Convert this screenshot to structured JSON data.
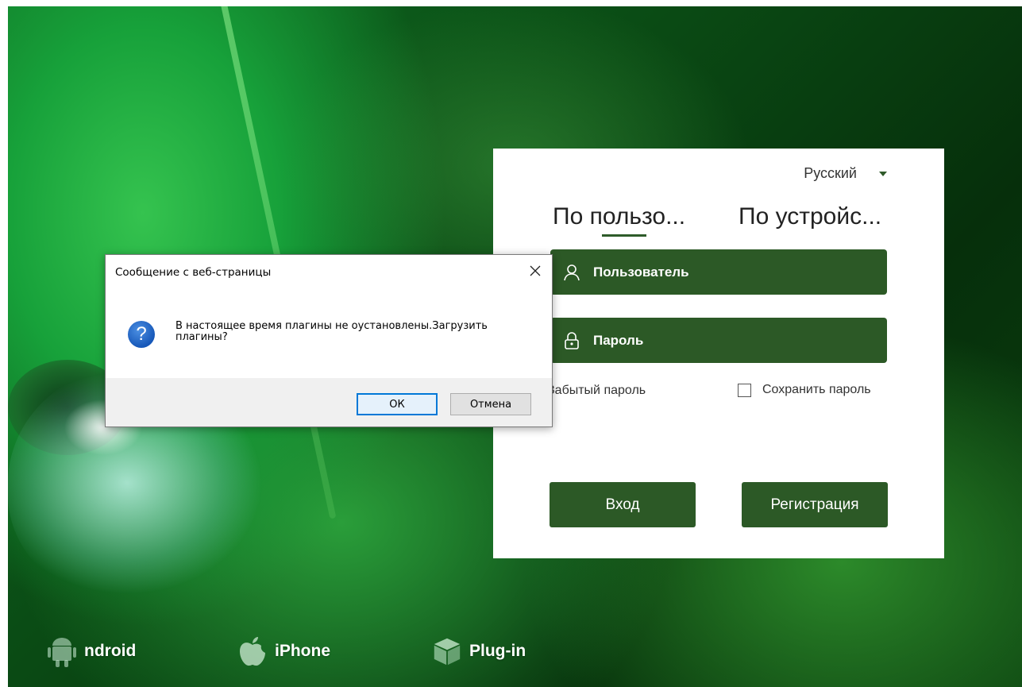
{
  "colors": {
    "accent_green": "#2c5926",
    "panel_bg": "#ffffff",
    "dialog_ok_border": "#0078d7"
  },
  "downloads": [
    {
      "label": "ndroid",
      "icon": "android-icon"
    },
    {
      "label": "iPhone",
      "icon": "apple-icon"
    },
    {
      "label": "Plug-in",
      "icon": "plugin-box-icon"
    }
  ],
  "login": {
    "language": "Русский",
    "tabs": [
      {
        "label": "По пользо...",
        "active": true
      },
      {
        "label": "По устройс...",
        "active": false
      }
    ],
    "username_placeholder": "Пользователь",
    "password_placeholder": "Пароль",
    "forgot_password": "Забытый пароль",
    "remember_password": "Сохранить пароль",
    "remember_checked": false,
    "login_button": "Вход",
    "register_button": "Регистрация"
  },
  "dialog": {
    "title": "Сообщение с веб-страницы",
    "icon": "question-icon",
    "message": "В настоящее время плагины не оустановлены.Загрузить плагины?",
    "ok": "ОК",
    "cancel": "Отмена"
  }
}
